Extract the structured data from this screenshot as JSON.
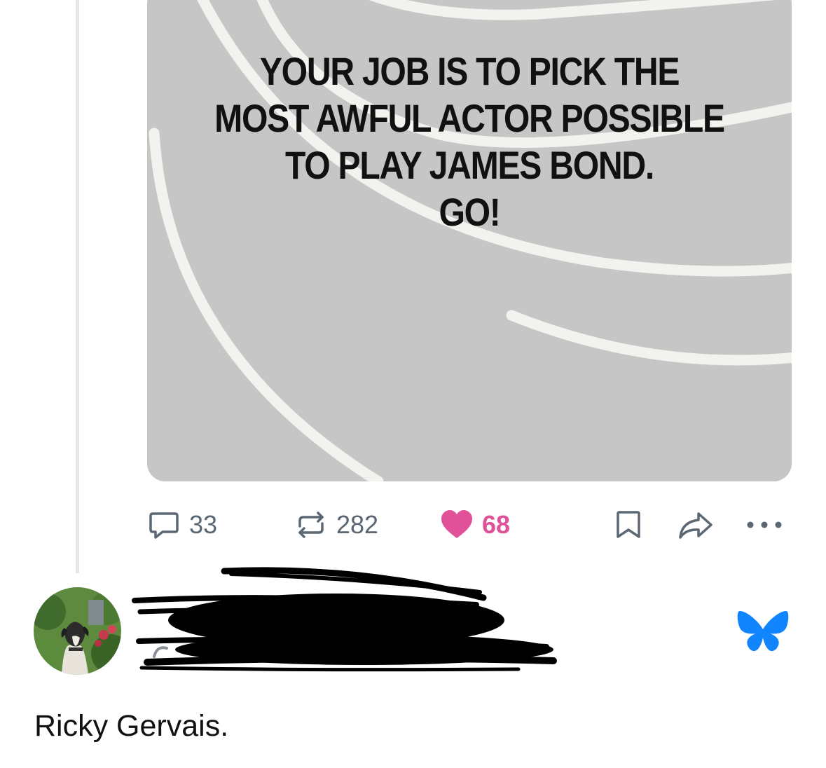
{
  "parent_post": {
    "image": {
      "lines": [
        "YOUR JOB IS TO PICK THE",
        "MOST AWFUL ACTOR POSSIBLE",
        "TO PLAY JAMES BOND.",
        "GO!"
      ]
    },
    "actions": {
      "replies": "33",
      "reposts": "282",
      "likes": "68",
      "liked": true
    },
    "colors": {
      "like": "#e0519a",
      "muted": "#5b6772",
      "image_bg": "#c7c7c7"
    }
  },
  "reply_post": {
    "author": {
      "avatar": "avatar-dog-photo",
      "name": "",
      "handle": "",
      "redacted": true
    },
    "app_icon": "bluesky-butterfly-icon",
    "text": "Ricky Gervais."
  }
}
